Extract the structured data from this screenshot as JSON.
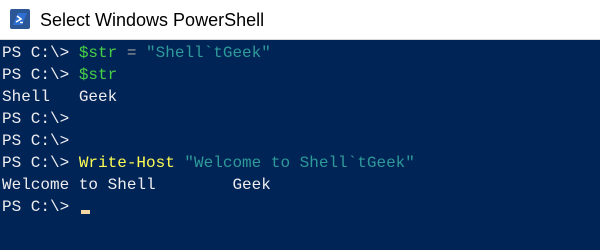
{
  "window": {
    "title": "Select Windows PowerShell",
    "icon": "powershell-icon"
  },
  "colors": {
    "background": "#012456",
    "text": "#eeedf0",
    "command": "#fdfd53",
    "variable": "#47d045",
    "string": "#2e9a9a",
    "cursor": "#f5d7a3"
  },
  "console": {
    "prompt": "PS C:\\> ",
    "lines": [
      {
        "variable": "$str",
        "operator": " = ",
        "string": "\"Shell`tGeek\""
      },
      {
        "variable": "$str"
      },
      {
        "output": "Shell   Geek"
      },
      {},
      {},
      {
        "command": "Write-Host",
        "string": " \"Welcome to Shell`tGeek\""
      },
      {
        "output": "Welcome to Shell        Geek"
      },
      {}
    ]
  }
}
